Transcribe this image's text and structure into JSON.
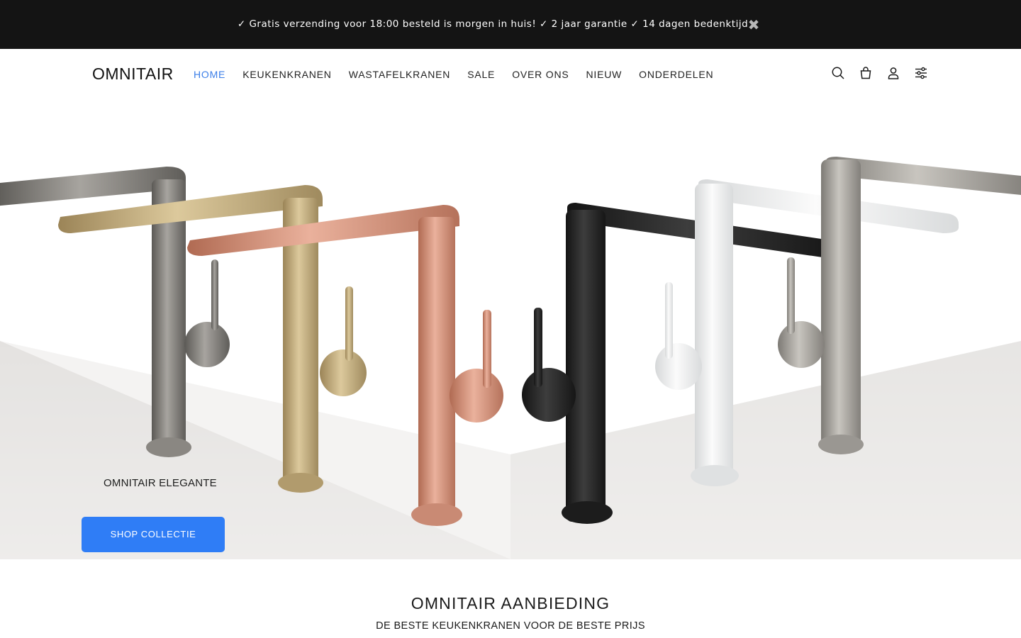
{
  "announcement": {
    "text": "✓ Gratis verzending voor 18:00 besteld is morgen in huis! ✓ 2 jaar garantie ✓ 14 dagen bedenktijd",
    "close_icon": "close-icon",
    "close_glyph": "✖"
  },
  "header": {
    "logo": "OMNITAIR",
    "nav": [
      {
        "label": "HOME",
        "active": true
      },
      {
        "label": "KEUKENKRANEN",
        "active": false
      },
      {
        "label": "WASTAFELKRANEN",
        "active": false
      },
      {
        "label": "SALE",
        "active": false
      },
      {
        "label": "OVER ONS",
        "active": false
      },
      {
        "label": "NIEUW",
        "active": false
      },
      {
        "label": "ONDERDELEN",
        "active": false
      }
    ],
    "icons": [
      "search-icon",
      "cart-icon",
      "account-icon",
      "filter-settings-icon"
    ]
  },
  "hero": {
    "caption": "OMNITAIR ELEGANTE",
    "button_label": "SHOP COLLECTIE",
    "faucet_finishes": [
      "gunmetal",
      "brushed-gold",
      "copper",
      "matte-black",
      "white",
      "brushed-steel"
    ]
  },
  "offer_section": {
    "title": "OMNITAIR AANBIEDING",
    "subtitle": "DE BESTE KEUKENKRANEN VOOR DE BESTE PRIJS"
  },
  "colors": {
    "announcement_bg": "#141414",
    "accent": "#3b7ee8",
    "button": "#2f7df6",
    "text": "#1a1a1a"
  }
}
